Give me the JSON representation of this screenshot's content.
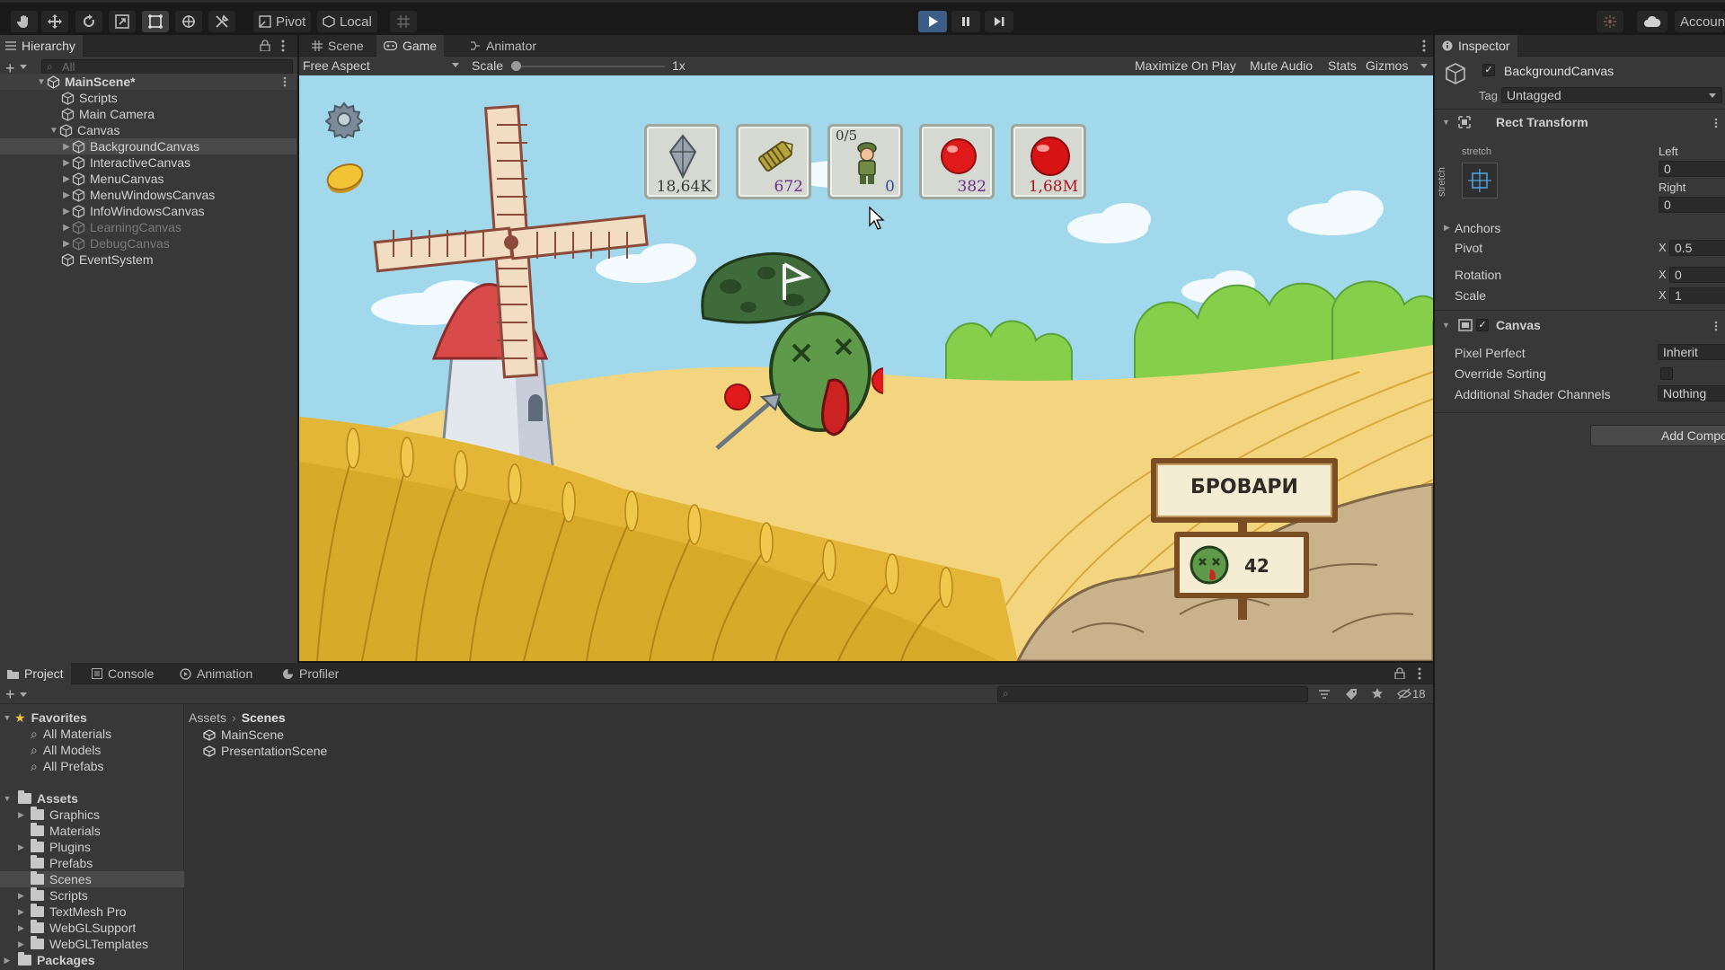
{
  "toolbar": {
    "pivot_label": "Pivot",
    "local_label": "Local",
    "account_label": "Accoun"
  },
  "hierarchy": {
    "title": "Hierarchy",
    "search_placeholder": "All",
    "scene_name": "MainScene*",
    "items": [
      {
        "label": "Scripts"
      },
      {
        "label": "Main Camera"
      },
      {
        "label": "Canvas"
      },
      {
        "label": "BackgroundCanvas"
      },
      {
        "label": "InteractiveCanvas"
      },
      {
        "label": "MenuCanvas"
      },
      {
        "label": "MenuWindowsCanvas"
      },
      {
        "label": "InfoWindowsCanvas"
      },
      {
        "label": "LearningCanvas"
      },
      {
        "label": "DebugCanvas"
      },
      {
        "label": "EventSystem"
      }
    ]
  },
  "center_tabs": {
    "scene": "Scene",
    "game": "Game",
    "animator": "Animator"
  },
  "game_toolbar": {
    "aspect": "Free Aspect",
    "scale_label": "Scale",
    "scale_value": "1x",
    "scale_fraction": 0.0,
    "maximize": "Maximize On Play",
    "mute": "Mute Audio",
    "stats": "Stats",
    "gizmos": "Gizmos"
  },
  "game": {
    "hud": [
      {
        "value": "18,64K",
        "icon": "crystal-icon"
      },
      {
        "value": "672",
        "icon": "ammo-icon"
      },
      {
        "value": "0",
        "top": "0/5",
        "icon": "soldier-icon"
      },
      {
        "value": "382",
        "icon": "red-orb-icon"
      },
      {
        "value": "1,68M",
        "icon": "big-red-orb-icon"
      }
    ],
    "sign_title": "БРОВАРИ",
    "sign_count": "42",
    "colors": {
      "sky": "#9fd6ea",
      "wheat": "#e6b93a",
      "field": "#f1d37d",
      "grass": "#8cd04a"
    }
  },
  "inspector": {
    "title": "Inspector",
    "object_name": "BackgroundCanvas",
    "tag_label": "Tag",
    "tag_value": "Untagged",
    "rect_transform": {
      "title": "Rect Transform",
      "stretch_h": "stretch",
      "stretch_v": "stretch",
      "left_label": "Left",
      "left_value": "0",
      "right_label": "Right",
      "right_value": "0",
      "anchors": "Anchors",
      "pivot": "Pivot",
      "pivot_x": "0.5",
      "rotation": "Rotation",
      "rotation_x": "0",
      "scale": "Scale",
      "scale_x": "1",
      "axis_x": "X"
    },
    "canvas": {
      "title": "Canvas",
      "pixel_perfect": "Pixel Perfect",
      "pixel_perfect_value": "Inherit",
      "override_sorting": "Override Sorting",
      "shader_channels": "Additional Shader Channels",
      "shader_channels_value": "Nothing"
    },
    "add_component": "Add Compo"
  },
  "bottom_tabs": {
    "project": "Project",
    "console": "Console",
    "animation": "Animation",
    "profiler": "Profiler",
    "hidden_count": "18"
  },
  "project": {
    "favorites": "Favorites",
    "favorite_items": [
      "All Materials",
      "All Models",
      "All Prefabs"
    ],
    "assets": "Assets",
    "asset_folders": [
      "Graphics",
      "Materials",
      "Plugins",
      "Prefabs",
      "Scenes",
      "Scripts",
      "TextMesh Pro",
      "WebGLSupport",
      "WebGLTemplates"
    ],
    "packages": "Packages",
    "breadcrumb_root": "Assets",
    "breadcrumb_current": "Scenes",
    "files": [
      "MainScene",
      "PresentationScene"
    ]
  }
}
